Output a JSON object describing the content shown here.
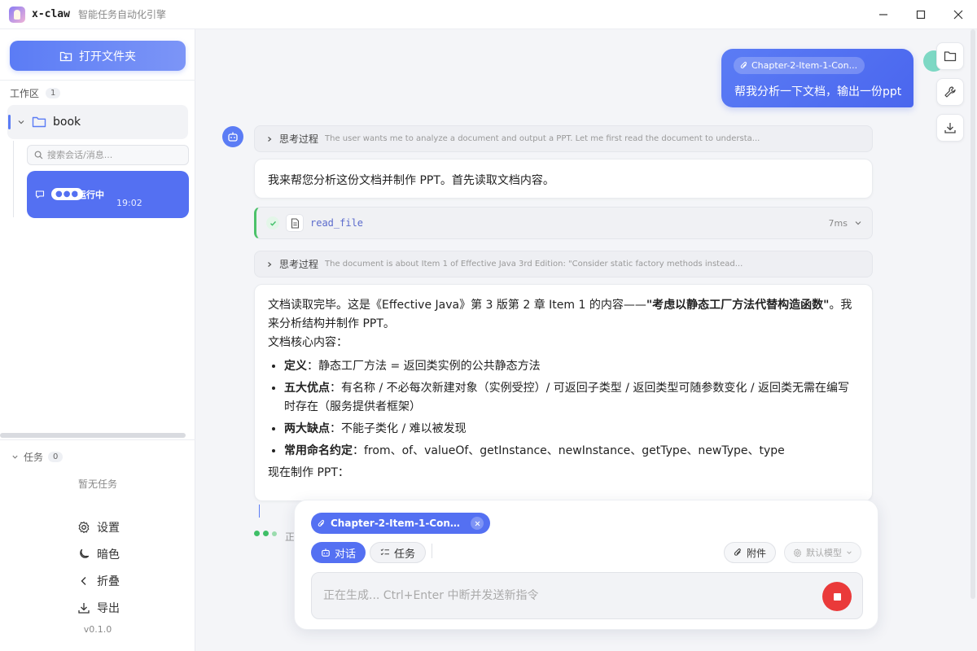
{
  "app": {
    "name": "x-claw",
    "subtitle": "智能任务自动化引擎"
  },
  "sidebar": {
    "open_folder_label": "打开文件夹",
    "workspace_label": "工作区",
    "workspace_count": "1",
    "folder_name": "book",
    "search_placeholder": "搜索会话/消息...",
    "session": {
      "status": "运行中",
      "time": "19:02"
    },
    "tasks_label": "任务",
    "tasks_count": "0",
    "no_tasks": "暂无任务",
    "actions": {
      "settings": "设置",
      "dark": "暗色",
      "collapse": "折叠",
      "export": "导出"
    },
    "version": "v0.1.0"
  },
  "chat": {
    "user_message": {
      "attachment": "Chapter-2-Item-1-Con...",
      "text": "帮我分析一下文档，输出一份ppt"
    },
    "think1": {
      "label": "思考过程",
      "text": "The user wants me to analyze a document and output a PPT. Let me first read the document to understa..."
    },
    "reply1": "我来帮您分析这份文档并制作 PPT。首先读取文档内容。",
    "tool": {
      "name": "read_file",
      "time": "7ms"
    },
    "think2": {
      "label": "思考过程",
      "text": "The document is about Item 1 of Effective Java 3rd Edition: \"Consider static factory methods instead..."
    },
    "doc": {
      "intro": "文档读取完毕。这是《Effective Java》第 3 版第 2 章 Item 1 的内容——",
      "intro_bold": "\"考虑以静态工厂方法代替构造函数\"",
      "intro_tail": "。我来分析结构并制作 PPT。",
      "core_label": "文档核心内容：",
      "bullets": [
        {
          "key": "定义",
          "text": "：静态工厂方法 = 返回类实例的公共静态方法"
        },
        {
          "key": "五大优点",
          "text": "：有名称 / 不必每次新建对象（实例受控）/ 可返回子类型 / 返回类型可随参数变化 / 返回类无需在编写时存在（服务提供者框架）"
        },
        {
          "key": "两大缺点",
          "text": "：不能子类化 / 难以被发现"
        },
        {
          "key": "常用命名约定",
          "text": "：from、of、valueOf、getInstance、newInstance、getType、newType、type"
        }
      ],
      "closing": "现在制作 PPT："
    },
    "generating_hint": "正"
  },
  "composer": {
    "attachment": "Chapter-2-Item-1-Consider...",
    "mode_chat": "对话",
    "mode_task": "任务",
    "attach_label": "附件",
    "model_label": "默认模型",
    "placeholder": "正在生成... Ctrl+Enter 中断并发送新指令"
  },
  "colors": {
    "accent": "#5470f2",
    "success": "#3fbf68",
    "stop": "#ea3a3a"
  }
}
